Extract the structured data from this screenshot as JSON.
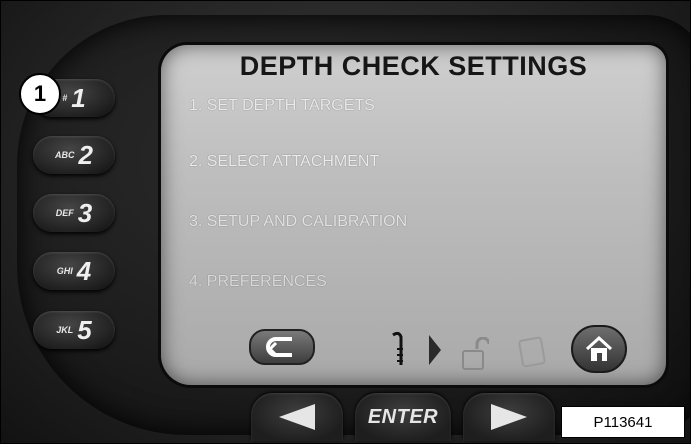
{
  "screen": {
    "title": "DEPTH CHECK SETTINGS",
    "menu": [
      {
        "label": "1. SET DEPTH TARGETS"
      },
      {
        "label": "2. SELECT ATTACHMENT"
      },
      {
        "label": "3. SETUP AND CALIBRATION"
      },
      {
        "label": "4. PREFERENCES"
      }
    ],
    "toolbar_icons": [
      "back-icon",
      "depth-probe-icon",
      "chevron-right-icon",
      "unlock-icon",
      "tablet-icon",
      "home-icon"
    ]
  },
  "keypad": [
    {
      "letters": "#",
      "number": "1"
    },
    {
      "letters": "ABC",
      "number": "2"
    },
    {
      "letters": "DEF",
      "number": "3"
    },
    {
      "letters": "GHI",
      "number": "4"
    },
    {
      "letters": "JKL",
      "number": "5"
    }
  ],
  "nav": {
    "enter_label": "ENTER"
  },
  "callout": "1",
  "photo_id": "P113641"
}
